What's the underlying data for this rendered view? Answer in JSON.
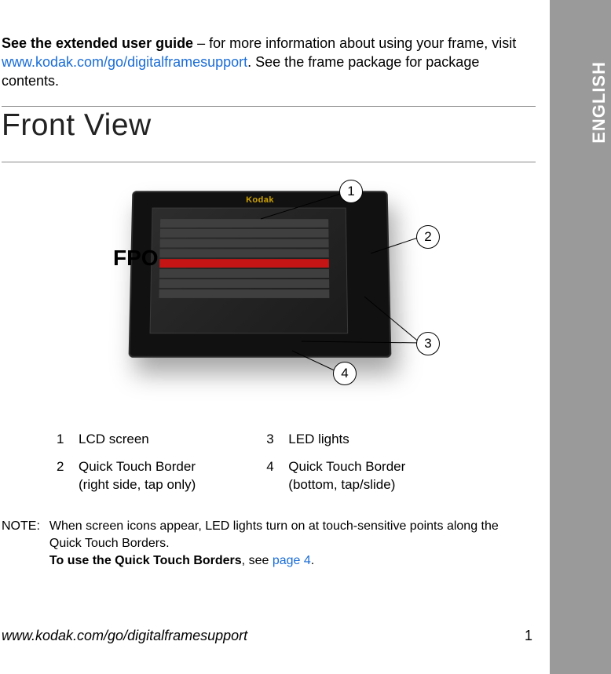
{
  "lang_tab": "ENGLISH",
  "intro": {
    "bold_lead": "See the extended user guide",
    "lead_rest": " – for more information about using your frame, visit ",
    "link": "www.kodak.com/go/digitalframesupport",
    "tail": ". See the frame package for package contents."
  },
  "section_title": "Front View",
  "figure": {
    "fpo_label": "FPO",
    "brand": "Kodak",
    "callouts": {
      "c1": "1",
      "c2": "2",
      "c3": "3",
      "c4": "4"
    }
  },
  "legend": {
    "left": [
      {
        "num": "1",
        "text": "LCD screen"
      },
      {
        "num": "2",
        "text": "Quick Touch Border",
        "sub": "(right side, tap only)"
      }
    ],
    "right": [
      {
        "num": "3",
        "text": "LED lights"
      },
      {
        "num": "4",
        "text": "Quick Touch Border",
        "sub": "(bottom, tap/slide)"
      }
    ]
  },
  "note": {
    "label": "NOTE:",
    "line1": "When screen icons appear, LED lights turn on at touch-sensitive points along the Quick Touch Borders.",
    "line2_bold": "To use the Quick Touch Borders",
    "line2_rest": ", see ",
    "line2_link": "page 4",
    "line2_tail": "."
  },
  "footer": {
    "url": "www.kodak.com/go/digitalframesupport",
    "page": "1"
  }
}
